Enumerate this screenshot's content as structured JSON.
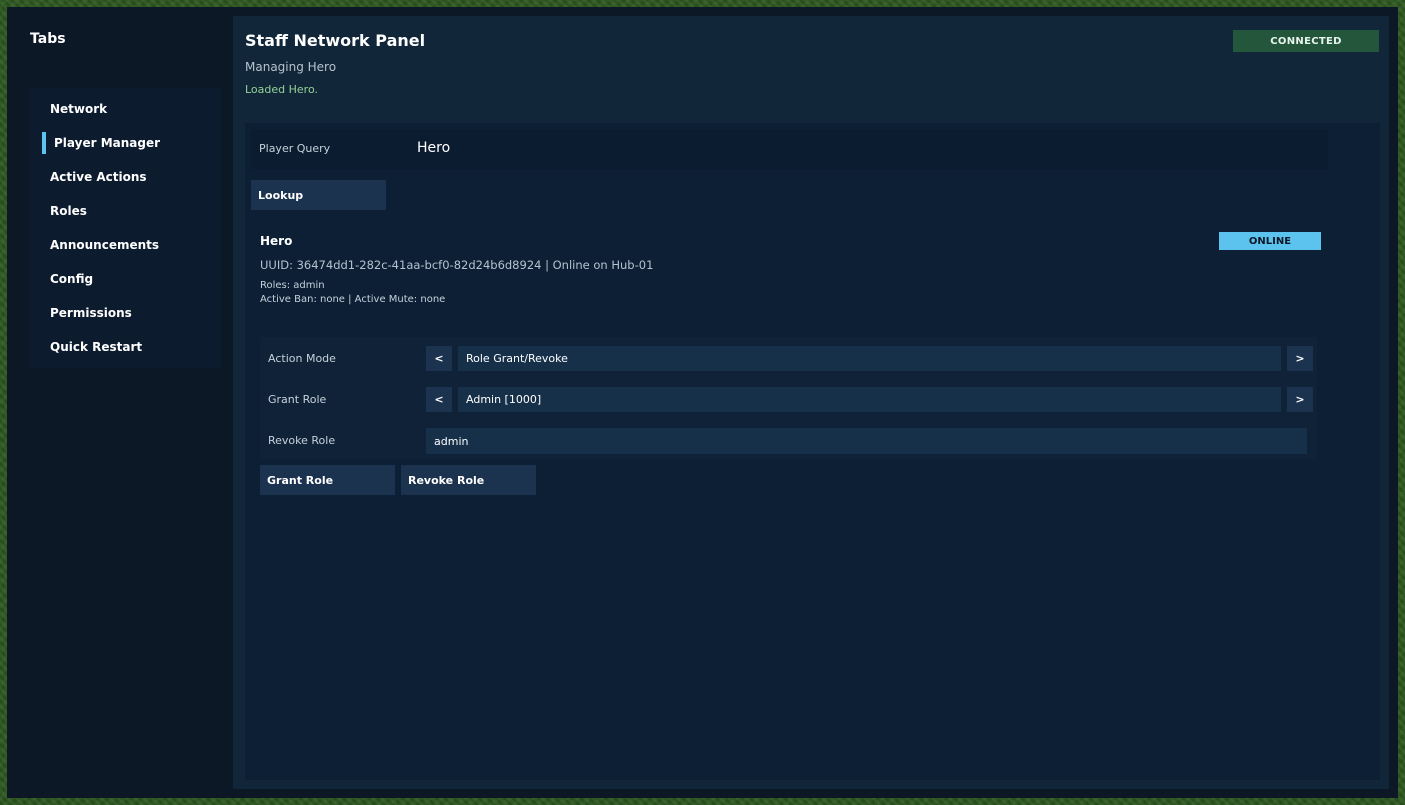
{
  "sidebar": {
    "title": "Tabs",
    "items": [
      {
        "label": "Network"
      },
      {
        "label": "Player Manager",
        "active": true
      },
      {
        "label": "Active Actions"
      },
      {
        "label": "Roles"
      },
      {
        "label": "Announcements"
      },
      {
        "label": "Config"
      },
      {
        "label": "Permissions"
      },
      {
        "label": "Quick Restart"
      }
    ]
  },
  "header": {
    "title": "Staff Network Panel",
    "subtitle": "Managing Hero",
    "status_message": "Loaded Hero.",
    "connection_badge": "CONNECTED"
  },
  "query": {
    "label": "Player Query",
    "value": "Hero",
    "lookup_label": "Lookup"
  },
  "player": {
    "name": "Hero",
    "status_badge": "ONLINE",
    "uuid_line": "UUID: 36474dd1-282c-41aa-bcf0-82d24b6d8924 | Online on Hub-01",
    "roles_line": "Roles: admin",
    "ban_mute_line": "Active Ban: none | Active Mute: none"
  },
  "form": {
    "action_mode": {
      "label": "Action Mode",
      "value": "Role Grant/Revoke",
      "prev": "<",
      "next": ">"
    },
    "grant_role": {
      "label": "Grant Role",
      "value": "Admin [1000]",
      "prev": "<",
      "next": ">"
    },
    "revoke_role": {
      "label": "Revoke Role",
      "value": "admin"
    }
  },
  "actions": {
    "grant_label": "Grant Role",
    "revoke_label": "Revoke Role"
  },
  "colors": {
    "accent": "#5bc3ee",
    "connected": "#24563b",
    "status_message": "#92d298"
  }
}
